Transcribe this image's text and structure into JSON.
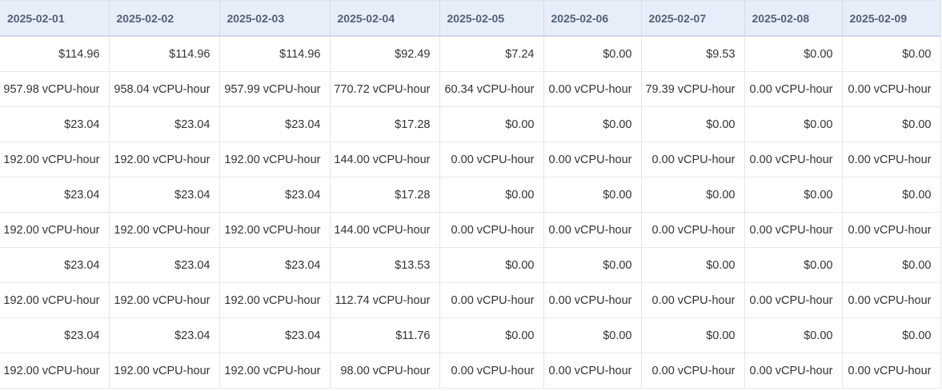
{
  "columns": [
    "2025-02-01",
    "2025-02-02",
    "2025-02-03",
    "2025-02-04",
    "2025-02-05",
    "2025-02-06",
    "2025-02-07",
    "2025-02-08",
    "2025-02-09"
  ],
  "rows": [
    [
      "$114.96",
      "$114.96",
      "$114.96",
      "$92.49",
      "$7.24",
      "$0.00",
      "$9.53",
      "$0.00",
      "$0.00"
    ],
    [
      "957.98 vCPU-hour",
      "958.04 vCPU-hour",
      "957.99 vCPU-hour",
      "770.72 vCPU-hour",
      "60.34 vCPU-hour",
      "0.00 vCPU-hour",
      "79.39 vCPU-hour",
      "0.00 vCPU-hour",
      "0.00 vCPU-hour"
    ],
    [
      "$23.04",
      "$23.04",
      "$23.04",
      "$17.28",
      "$0.00",
      "$0.00",
      "$0.00",
      "$0.00",
      "$0.00"
    ],
    [
      "192.00 vCPU-hour",
      "192.00 vCPU-hour",
      "192.00 vCPU-hour",
      "144.00 vCPU-hour",
      "0.00 vCPU-hour",
      "0.00 vCPU-hour",
      "0.00 vCPU-hour",
      "0.00 vCPU-hour",
      "0.00 vCPU-hour"
    ],
    [
      "$23.04",
      "$23.04",
      "$23.04",
      "$17.28",
      "$0.00",
      "$0.00",
      "$0.00",
      "$0.00",
      "$0.00"
    ],
    [
      "192.00 vCPU-hour",
      "192.00 vCPU-hour",
      "192.00 vCPU-hour",
      "144.00 vCPU-hour",
      "0.00 vCPU-hour",
      "0.00 vCPU-hour",
      "0.00 vCPU-hour",
      "0.00 vCPU-hour",
      "0.00 vCPU-hour"
    ],
    [
      "$23.04",
      "$23.04",
      "$23.04",
      "$13.53",
      "$0.00",
      "$0.00",
      "$0.00",
      "$0.00",
      "$0.00"
    ],
    [
      "192.00 vCPU-hour",
      "192.00 vCPU-hour",
      "192.00 vCPU-hour",
      "112.74 vCPU-hour",
      "0.00 vCPU-hour",
      "0.00 vCPU-hour",
      "0.00 vCPU-hour",
      "0.00 vCPU-hour",
      "0.00 vCPU-hour"
    ],
    [
      "$23.04",
      "$23.04",
      "$23.04",
      "$11.76",
      "$0.00",
      "$0.00",
      "$0.00",
      "$0.00",
      "$0.00"
    ],
    [
      "192.00 vCPU-hour",
      "192.00 vCPU-hour",
      "192.00 vCPU-hour",
      "98.00 vCPU-hour",
      "0.00 vCPU-hour",
      "0.00 vCPU-hour",
      "0.00 vCPU-hour",
      "0.00 vCPU-hour",
      "0.00 vCPU-hour"
    ]
  ]
}
